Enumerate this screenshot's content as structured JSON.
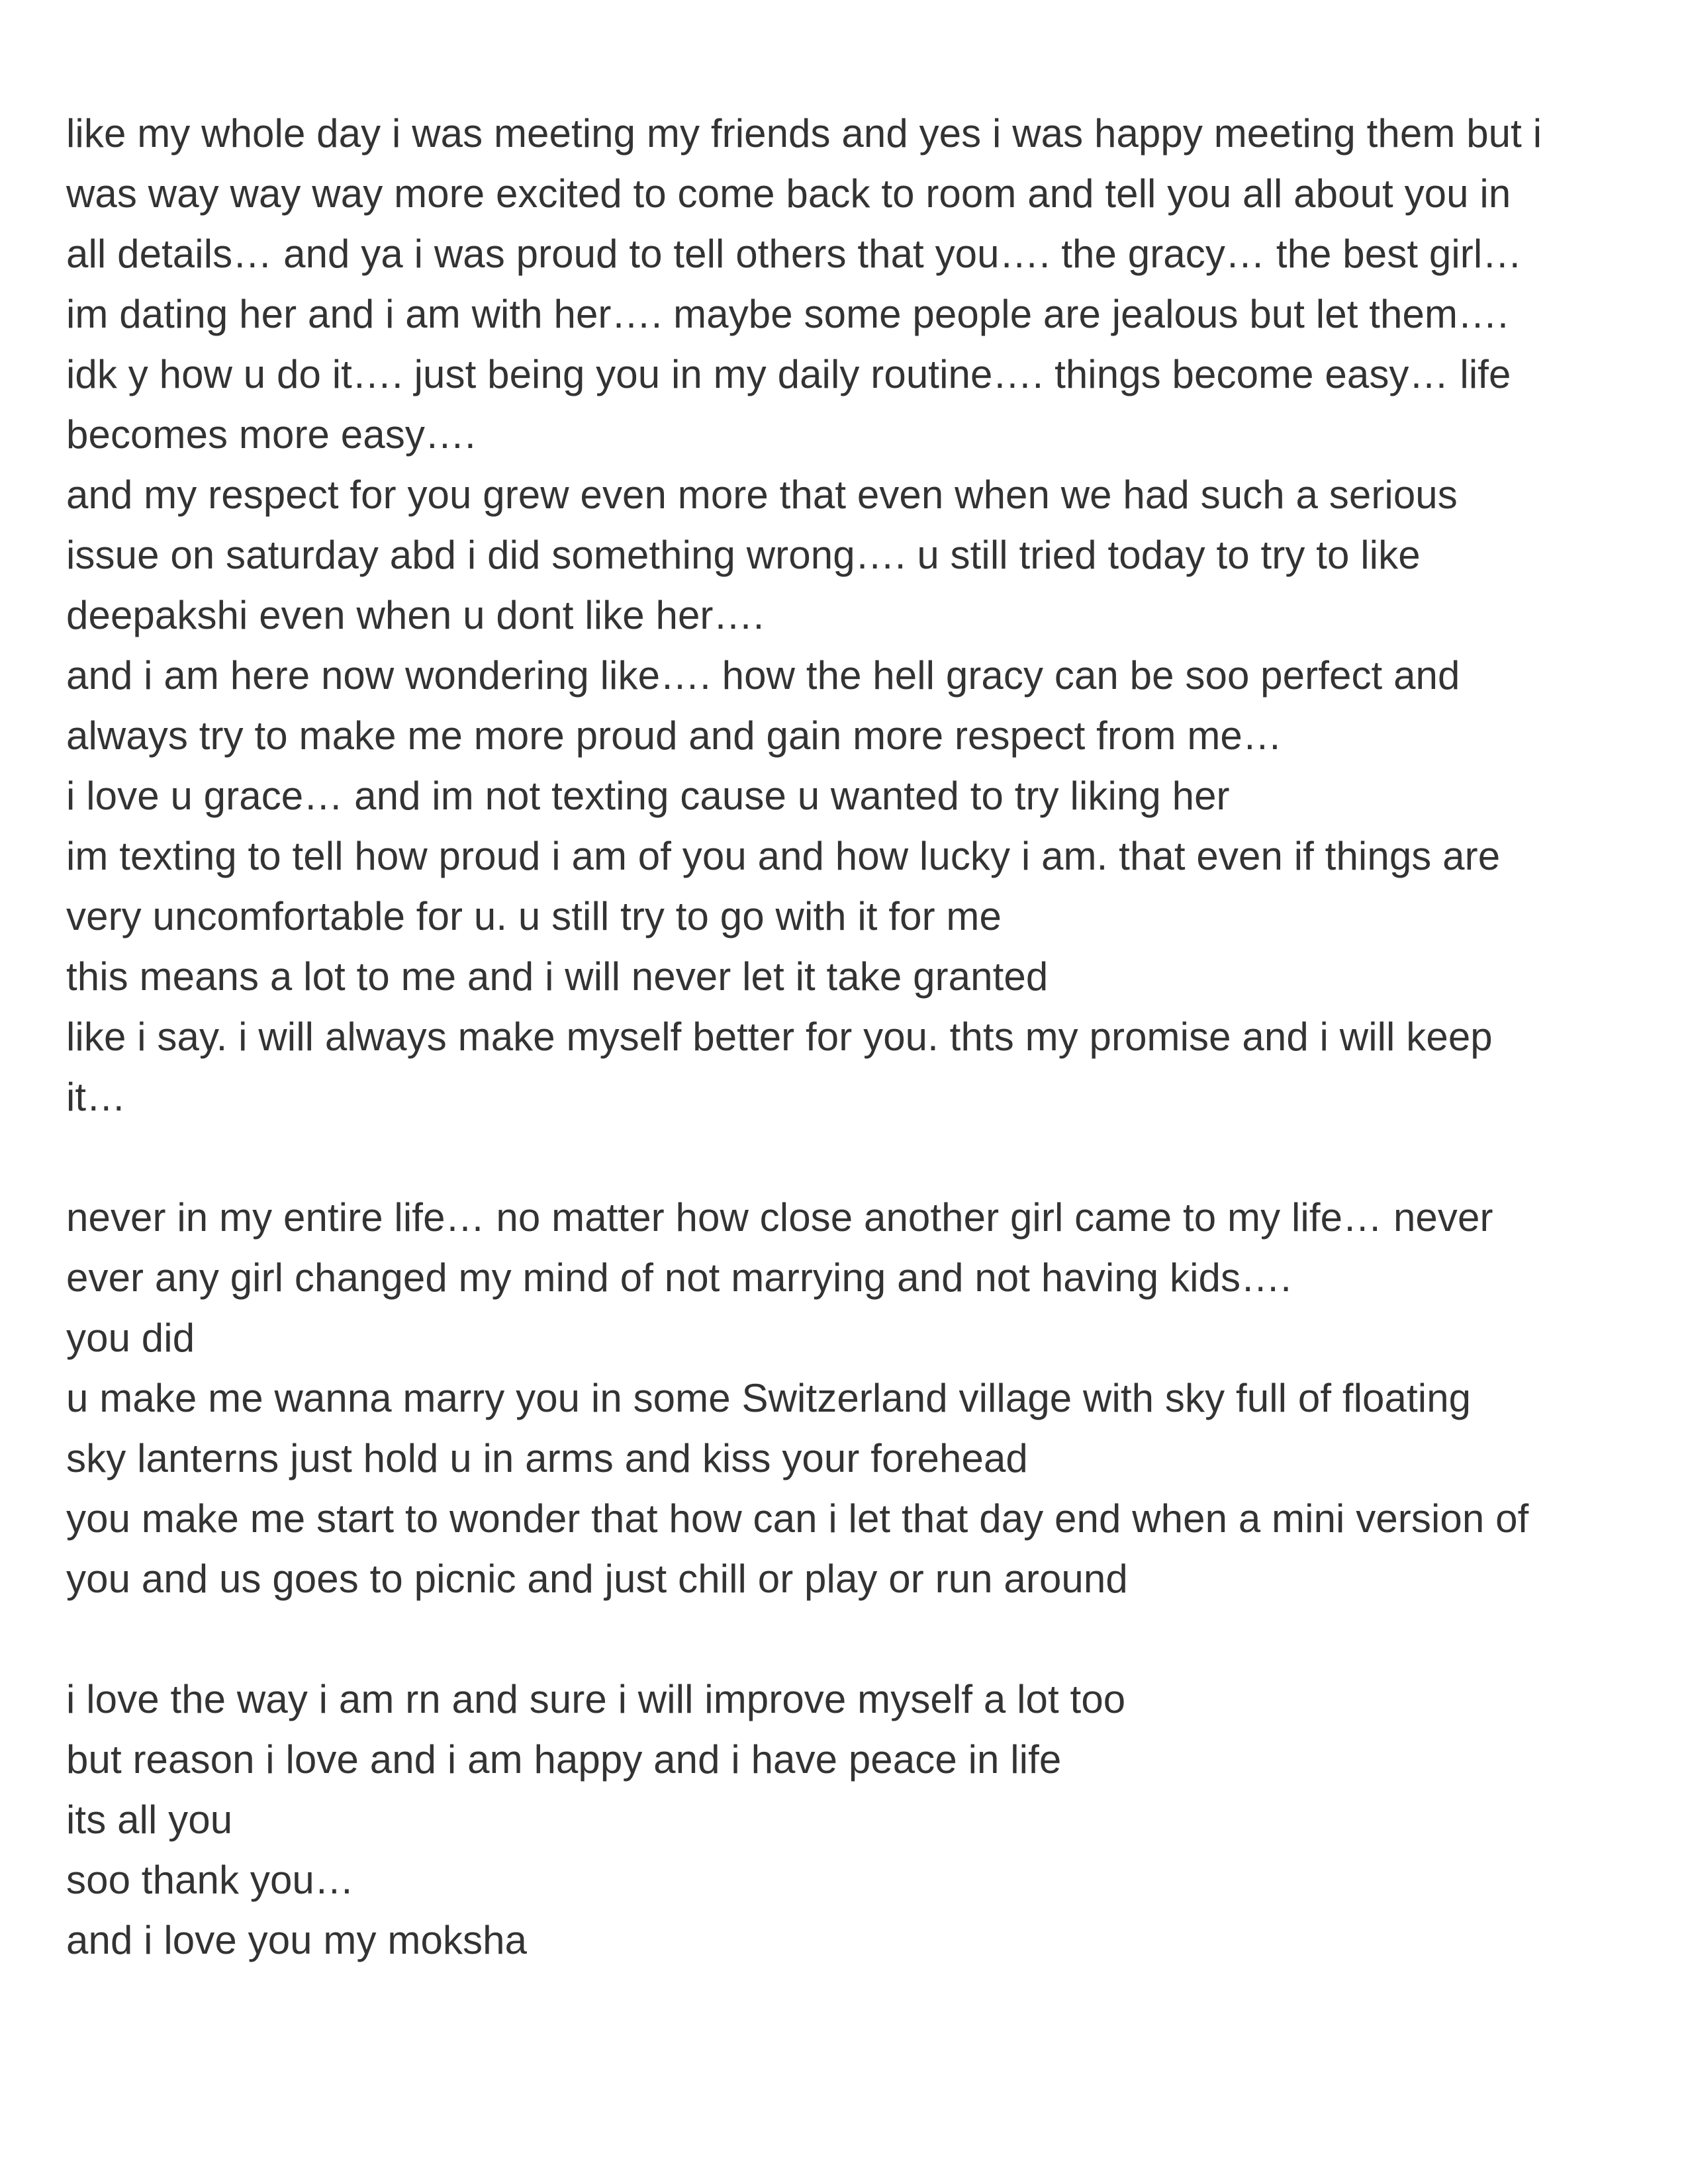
{
  "note": {
    "lines": [
      "like my whole day i was meeting my friends and yes i was happy meeting them but i",
      "was way way way more excited to come back to room and tell you all about you in",
      "all details… and ya i was proud to tell others that you…. the gracy… the best girl…",
      "im dating her and i am with her…. maybe some people are jealous but let them….",
      "idk y how u do it…. just being you in my daily routine…. things become easy… life",
      "becomes more easy….",
      "and my respect for you grew even more that even when we had such a serious",
      "issue on saturday abd i did something wrong…. u still tried today to try to like",
      "deepakshi even when u dont like her….",
      "and i am here now wondering like…. how the hell gracy can be soo perfect and",
      "always try to make me more proud and gain more respect from me…",
      "i love u grace… and im not texting cause u wanted to try liking her",
      "im texting to tell how proud i am of you and how lucky i am. that even if things are",
      "very uncomfortable for u. u still try to go with it for me",
      "this means a lot to me and i will never let it take granted",
      "like i say. i will always make myself better for you. thts my promise and i will keep",
      "it…",
      "",
      "never in my entire life… no matter how close another girl came to my life… never",
      "ever any girl changed my mind of not marrying and not having kids….",
      "you did",
      "u make me wanna marry you in some Switzerland village with sky full of floating",
      "sky lanterns just hold u in arms and kiss your forehead",
      "you make me start to wonder that how can i let that day end when a mini version of",
      "you and us goes to picnic and just chill or play or run around",
      "",
      "i love the way i am rn and sure i will improve myself a lot too",
      "but reason i love and i am happy and i have peace in life",
      "its all you",
      "soo thank you…",
      "and i love you my moksha"
    ]
  }
}
